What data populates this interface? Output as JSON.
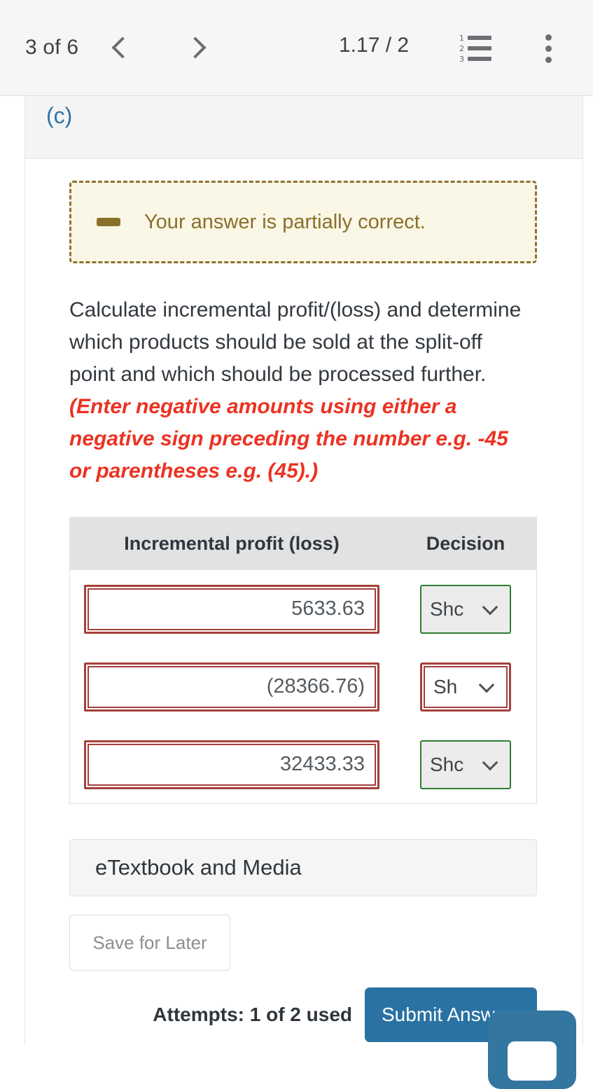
{
  "toolbar": {
    "page_indicator": "3 of 6",
    "prev_icon": "chevron-left-icon",
    "next_icon": "chevron-right-icon",
    "zoom_level": "1.17 / 2",
    "list_icon": "numbered-list-icon",
    "list_numbers": [
      "1",
      "2",
      "3"
    ],
    "menu_icon": "kebab-menu-icon"
  },
  "section": {
    "label": "(c)"
  },
  "alert": {
    "icon": "minus-icon",
    "text": "Your answer is partially correct.",
    "bg_color": "#faf7e6",
    "border_color": "#8d7331",
    "text_color": "#8a6f2b"
  },
  "question": {
    "body": "Calculate incremental profit/(loss) and determine which products should be sold at the split-off point and which should be processed further. ",
    "hint": "(Enter negative amounts using either a negative sign preceding the number e.g. -45 or parentheses e.g. (45).)",
    "hint_color": "#ea3323"
  },
  "table": {
    "headers": {
      "amount": "Incremental profit (loss)",
      "decision": "Decision"
    },
    "rows": [
      {
        "row_label": ")",
        "amount": "5633.63",
        "amount_state": "incorrect",
        "decision": "Shc",
        "decision_state": "correct"
      },
      {
        "row_label": ")",
        "amount": "(28366.76)",
        "amount_state": "incorrect",
        "decision": "Sh",
        "decision_state": "incorrect"
      },
      {
        "row_label": ")",
        "amount": "32433.33",
        "amount_state": "incorrect",
        "decision": "Shc",
        "decision_state": "correct"
      }
    ],
    "incorrect_color": "#a43f3b",
    "correct_color": "#2e7d32"
  },
  "etextbook": {
    "label": "eTextbook and Media"
  },
  "footer": {
    "save_for_later": "Save for Later",
    "attempts": "Attempts: 1 of 2 used",
    "submit": "Submit Answer",
    "submit_color": "#2a72a3"
  }
}
